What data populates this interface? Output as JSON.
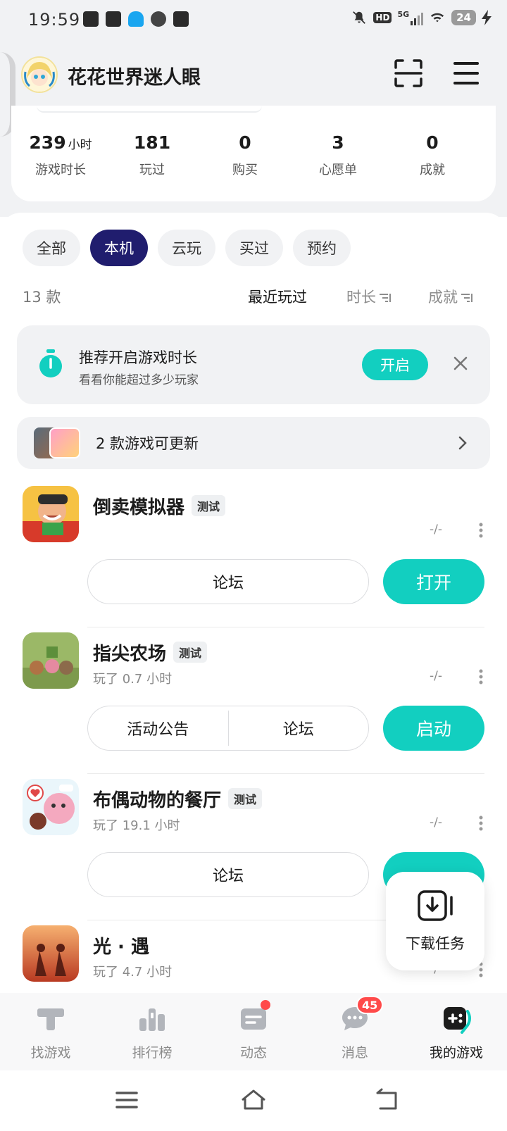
{
  "status_bar": {
    "time": "19:59",
    "battery": "24",
    "network": "5G",
    "hd": "HD",
    "icons": [
      "video-icon",
      "game-icon",
      "qq-icon",
      "link-icon",
      "tiktok-icon",
      "mute-icon",
      "signal-icon",
      "wifi-icon",
      "charging-icon"
    ]
  },
  "header": {
    "username": "花花世界迷人眼",
    "icons": [
      "scan-icon",
      "menu-icon"
    ]
  },
  "stats": [
    {
      "value": "239",
      "unit": "小时",
      "label": "游戏时长"
    },
    {
      "value": "181",
      "unit": "",
      "label": "玩过"
    },
    {
      "value": "0",
      "unit": "",
      "label": "购买"
    },
    {
      "value": "3",
      "unit": "",
      "label": "心愿单"
    },
    {
      "value": "0",
      "unit": "",
      "label": "成就"
    }
  ],
  "filter_tabs": [
    "全部",
    "本机",
    "云玩",
    "买过",
    "预约"
  ],
  "active_tab": "本机",
  "sort_bar": {
    "count": "13 款",
    "recent": "最近玩过",
    "time": "时长",
    "achievement": "成就"
  },
  "tip": {
    "title": "推荐开启游戏时长",
    "subtitle": "看看你能超过多少玩家",
    "button": "开启"
  },
  "update_banner": {
    "text": "2 款游戏可更新"
  },
  "games": [
    {
      "name": "倒卖模拟器",
      "badge": "测试",
      "played": "",
      "score": "-/-",
      "forum": "论坛",
      "action": "打开"
    },
    {
      "name": "指尖农场",
      "badge": "测试",
      "played": "玩了 0.7 小时",
      "score": "-/-",
      "announce": "活动公告",
      "forum": "论坛",
      "action": "启动"
    },
    {
      "name": "布偶动物的餐厅",
      "badge": "测试",
      "played": "玩了 19.1 小时",
      "score": "-/-",
      "forum": "论坛",
      "action": "启动"
    },
    {
      "name": "光 · 遇",
      "badge": "",
      "played": "玩了 4.7 小时",
      "score": "-/-"
    }
  ],
  "download_task": {
    "label": "下载任务"
  },
  "bottom_nav": [
    {
      "label": "找游戏",
      "icon": "find-game-icon"
    },
    {
      "label": "排行榜",
      "icon": "ranking-icon"
    },
    {
      "label": "动态",
      "icon": "feed-icon"
    },
    {
      "label": "消息",
      "icon": "message-icon",
      "badge": "45"
    },
    {
      "label": "我的游戏",
      "icon": "my-games-icon",
      "active": true
    }
  ],
  "colors": {
    "accent": "#12cfc0",
    "active_tab": "#201d6e",
    "badge_red": "#ff4a4a"
  }
}
